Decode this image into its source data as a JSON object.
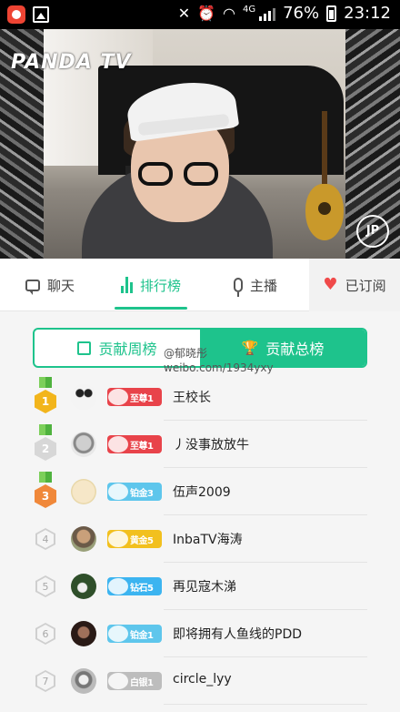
{
  "status_bar": {
    "network": "4G",
    "battery_percent": "76%",
    "time": "23:12"
  },
  "video": {
    "logo": "PANDA TV",
    "corner_badge": "JP"
  },
  "tabs": [
    {
      "label": "聊天",
      "icon": "chat-icon"
    },
    {
      "label": "排行榜",
      "icon": "ranking-chart-icon",
      "active": true
    },
    {
      "label": "主播",
      "icon": "microphone-icon"
    },
    {
      "label": "已订阅",
      "icon": "heart-icon"
    }
  ],
  "segment": {
    "weekly_label": "贡献周榜",
    "total_label": "贡献总榜",
    "active": "total"
  },
  "watermark": {
    "line1": "@郁晓彤",
    "line2": "weibo.com/1934yxy"
  },
  "colors": {
    "accent": "#1ec38c",
    "medal_gold": "#f2b51c",
    "medal_silver": "#d7d7d7",
    "medal_bronze": "#f0883a"
  },
  "leaderboard": [
    {
      "rank": "1",
      "medal": "gold",
      "badge_text": "至尊1",
      "badge_color": "#e8434a",
      "name": "王校长",
      "avatar": "panda"
    },
    {
      "rank": "2",
      "medal": "silver",
      "badge_text": "至尊1",
      "badge_color": "#e8434a",
      "name": "丿没事放放牛",
      "avatar": "sketch"
    },
    {
      "rank": "3",
      "medal": "bronze",
      "badge_text": "铂金3",
      "badge_color": "#5ec6ec",
      "name": "伍声2009",
      "avatar": "face"
    },
    {
      "rank": "4",
      "medal": "none",
      "badge_text": "黄金5",
      "badge_color": "#f2c01e",
      "name": "InbaTV海涛",
      "avatar": "man"
    },
    {
      "rank": "5",
      "medal": "none",
      "badge_text": "钻石5",
      "badge_color": "#3cb4f0",
      "name": "再见寇木涕",
      "avatar": "green"
    },
    {
      "rank": "6",
      "medal": "none",
      "badge_text": "铂金1",
      "badge_color": "#5ec6ec",
      "name": "即将拥有人鱼线的PDD",
      "avatar": "dark"
    },
    {
      "rank": "7",
      "medal": "none",
      "badge_text": "白银1",
      "badge_color": "#bdbdbd",
      "name": "circle_lyy",
      "avatar": "grey"
    }
  ]
}
